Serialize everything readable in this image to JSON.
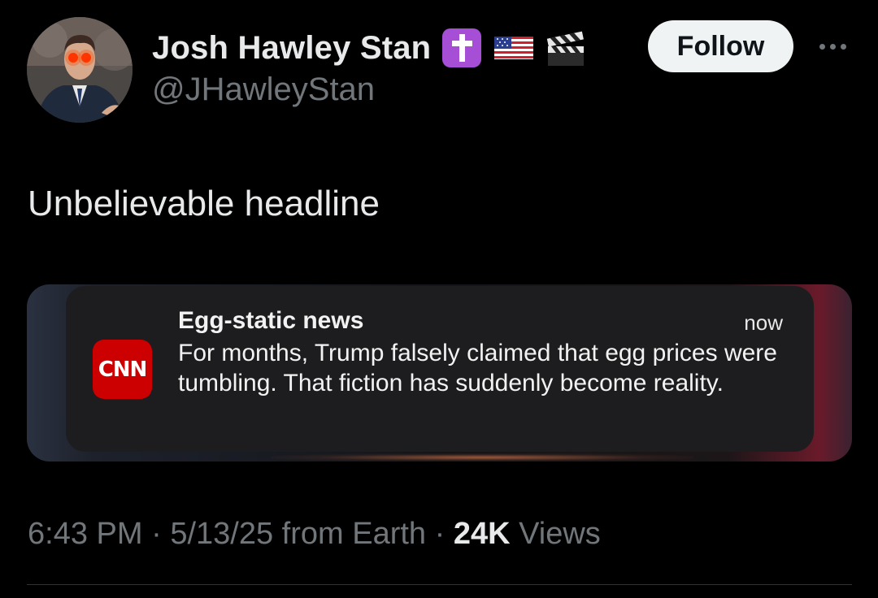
{
  "author": {
    "display_name": "Josh Hawley Stan",
    "handle": "@JHawleyStan",
    "name_emojis": [
      "latin-cross-emoji",
      "us-flag-emoji",
      "clapper-board-emoji"
    ]
  },
  "actions": {
    "follow_label": "Follow",
    "more_icon": "more-horizontal-icon"
  },
  "tweet": {
    "text": "Unbelievable headline"
  },
  "notification": {
    "app_logo": "CNN",
    "title": "Egg-static news",
    "time": "now",
    "body": "For months, Trump falsely claimed that egg prices were tumbling. That fiction has suddenly become reality."
  },
  "meta": {
    "time": "6:43 PM",
    "sep1": "·",
    "date": "5/13/25",
    "source": "from Earth",
    "sep2": "·",
    "views_count": "24K",
    "views_label": "Views"
  },
  "colors": {
    "background": "#000000",
    "primary_text": "#e7e9ea",
    "secondary_text": "#71767b",
    "follow_bg": "#eff3f4",
    "cnn_red": "#cc0000",
    "cross_badge": "#a64fd6"
  }
}
